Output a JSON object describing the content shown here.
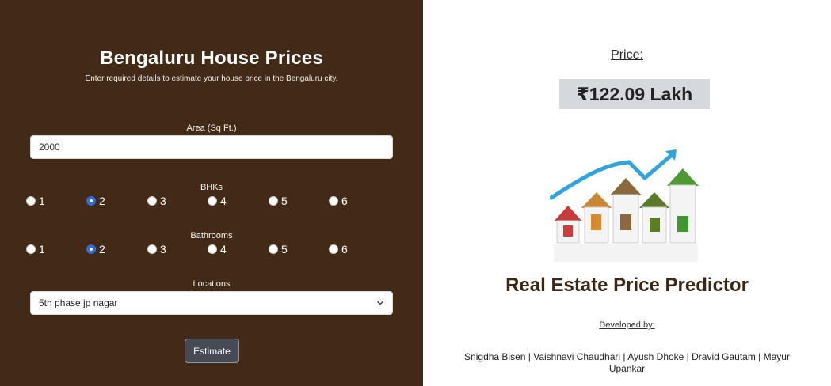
{
  "form": {
    "title": "Bengaluru House Prices",
    "subtitle": "Enter required details to estimate your house price in the Bengaluru city.",
    "area": {
      "label": "Area (Sq Ft.)",
      "value": "2000"
    },
    "bhk": {
      "label": "BHKs",
      "options": [
        "1",
        "2",
        "3",
        "4",
        "5",
        "6"
      ],
      "selected": "2"
    },
    "bath": {
      "label": "Bathrooms",
      "options": [
        "1",
        "2",
        "3",
        "4",
        "5",
        "6"
      ],
      "selected": "2"
    },
    "location": {
      "label": "Locations",
      "value": "5th phase jp nagar"
    },
    "estimate_label": "Estimate"
  },
  "result": {
    "price_label": "Price:",
    "price_value": "₹122.09 Lakh",
    "app_title": "Real Estate Price Predictor",
    "developed_by": "Developed by:",
    "developers": "Snigdha Bisen | Vaishnavi Chaudhari | Ayush Dhoke | Dravid Gautam | Mayur Upankar"
  },
  "colors": {
    "left_bg": "#422a16",
    "right_bg": "#ffffff",
    "accent": "#2a6fdb",
    "price_box_bg": "#d5d9de",
    "title_brown": "#3c2614"
  }
}
